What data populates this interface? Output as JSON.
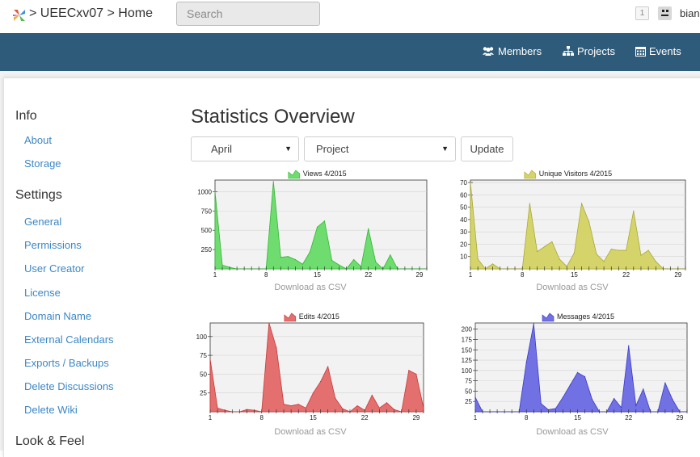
{
  "header": {
    "breadcrumb": [
      ">",
      "UEECxv07",
      ">",
      "Home"
    ],
    "search": {
      "placeholder": "Search"
    },
    "notifications_count": "1",
    "username": "biank"
  },
  "nav": {
    "items": [
      {
        "label": "Members",
        "icon": "users-icon"
      },
      {
        "label": "Projects",
        "icon": "sitemap-icon"
      },
      {
        "label": "Events",
        "icon": "calendar-icon"
      }
    ]
  },
  "sidebar": {
    "sections": [
      {
        "heading": "Info",
        "links": [
          "About",
          "Storage"
        ]
      },
      {
        "heading": "Settings",
        "links": [
          "General",
          "Permissions",
          "User Creator",
          "License",
          "Domain Name",
          "External Calendars",
          "Exports / Backups",
          "Delete Discussions",
          "Delete Wiki"
        ]
      },
      {
        "heading": "Look & Feel",
        "links": []
      }
    ]
  },
  "main": {
    "title": "Statistics Overview",
    "month_select": "April",
    "project_select": "Project",
    "update_label": "Update",
    "download_label": "Download as CSV"
  },
  "chart_data": [
    {
      "type": "area",
      "title": "Views 4/2015",
      "color": "#6fdc6f",
      "stroke": "#33b533",
      "xlim": [
        1,
        30
      ],
      "xticks": [
        1,
        8,
        15,
        22,
        29
      ],
      "ylim": [
        0,
        1150
      ],
      "yticks": [
        250,
        500,
        750,
        1000
      ],
      "x": [
        1,
        2,
        3,
        4,
        5,
        6,
        7,
        8,
        9,
        10,
        11,
        12,
        13,
        14,
        15,
        16,
        17,
        18,
        19,
        20,
        21,
        22,
        23,
        24,
        25,
        26,
        27,
        28,
        29,
        30
      ],
      "values": [
        1000,
        50,
        20,
        0,
        0,
        0,
        0,
        0,
        1130,
        150,
        160,
        120,
        60,
        220,
        540,
        620,
        110,
        50,
        0,
        120,
        30,
        520,
        90,
        0,
        180,
        0,
        0,
        0,
        0,
        0
      ]
    },
    {
      "type": "area",
      "title": "Unique Visitors 4/2015",
      "color": "#d4d46a",
      "stroke": "#a8a83a",
      "xlim": [
        1,
        30
      ],
      "xticks": [
        1,
        8,
        15,
        22,
        29
      ],
      "ylim": [
        0,
        72
      ],
      "yticks": [
        10,
        20,
        30,
        40,
        50,
        60,
        70
      ],
      "x": [
        1,
        2,
        3,
        4,
        5,
        6,
        7,
        8,
        9,
        10,
        11,
        12,
        13,
        14,
        15,
        16,
        17,
        18,
        19,
        20,
        21,
        22,
        23,
        24,
        25,
        26,
        27,
        28,
        29,
        30
      ],
      "values": [
        70,
        8,
        0,
        4,
        0,
        0,
        0,
        0,
        53,
        14,
        18,
        22,
        8,
        2,
        13,
        53,
        38,
        12,
        6,
        16,
        15,
        15,
        47,
        11,
        15,
        6,
        0,
        0,
        0,
        0
      ]
    },
    {
      "type": "area",
      "title": "Edits 4/2015",
      "color": "#e46f6f",
      "stroke": "#c73a3a",
      "xlim": [
        1,
        30
      ],
      "xticks": [
        1,
        8,
        15,
        22,
        29
      ],
      "ylim": [
        0,
        118
      ],
      "yticks": [
        25,
        50,
        75,
        100
      ],
      "x": [
        1,
        2,
        3,
        4,
        5,
        6,
        7,
        8,
        9,
        10,
        11,
        12,
        13,
        14,
        15,
        16,
        17,
        18,
        19,
        20,
        21,
        22,
        23,
        24,
        25,
        26,
        27,
        28,
        29,
        30
      ],
      "values": [
        70,
        5,
        2,
        0,
        0,
        3,
        2,
        0,
        118,
        85,
        10,
        8,
        10,
        5,
        25,
        40,
        60,
        18,
        4,
        0,
        8,
        2,
        22,
        5,
        12,
        3,
        0,
        55,
        50,
        5
      ]
    },
    {
      "type": "area",
      "title": "Messages 4/2015",
      "color": "#7171e4",
      "stroke": "#3a3ac7",
      "xlim": [
        1,
        30
      ],
      "xticks": [
        1,
        8,
        15,
        22,
        29
      ],
      "ylim": [
        0,
        215
      ],
      "yticks": [
        25,
        50,
        75,
        100,
        125,
        150,
        175,
        200
      ],
      "x": [
        1,
        2,
        3,
        4,
        5,
        6,
        7,
        8,
        9,
        10,
        11,
        12,
        13,
        14,
        15,
        16,
        17,
        18,
        19,
        20,
        21,
        22,
        23,
        24,
        25,
        26,
        27,
        28,
        29,
        30
      ],
      "values": [
        35,
        0,
        0,
        0,
        0,
        0,
        0,
        120,
        213,
        20,
        5,
        8,
        35,
        65,
        95,
        85,
        30,
        0,
        0,
        32,
        10,
        160,
        15,
        55,
        0,
        0,
        70,
        30,
        0,
        0
      ]
    }
  ]
}
